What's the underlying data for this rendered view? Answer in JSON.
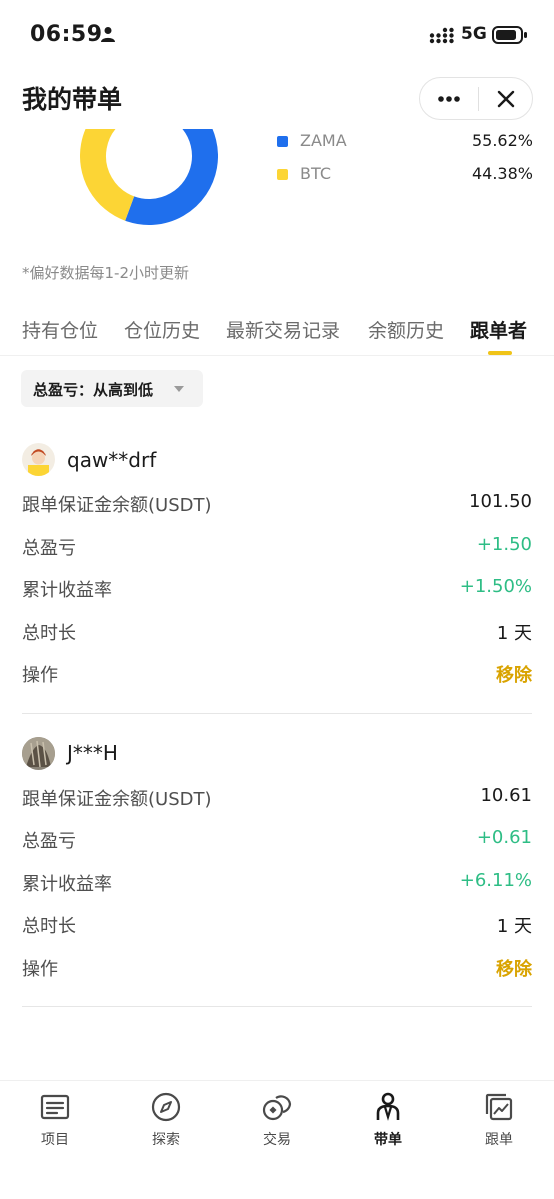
{
  "status_bar": {
    "time": "06:59",
    "network": "5G"
  },
  "header": {
    "title": "我的带单",
    "more_icon": "more-dots-icon",
    "close_icon": "close-icon"
  },
  "allocation": {
    "items": [
      {
        "name": "ZAMA",
        "value": "55.62%",
        "percent": 55.62,
        "color": "#1f6fed"
      },
      {
        "name": "BTC",
        "value": "44.38%",
        "percent": 44.38,
        "color": "#fcd535"
      }
    ],
    "note": "*偏好数据每1-2小时更新"
  },
  "tabs": [
    {
      "label": "持有仓位",
      "active": false
    },
    {
      "label": "仓位历史",
      "active": false
    },
    {
      "label": "最新交易记录",
      "active": false
    },
    {
      "label": "余额历史",
      "active": false
    },
    {
      "label": "跟单者",
      "active": true
    }
  ],
  "sort": {
    "label": "总盈亏：从高到低"
  },
  "followers": [
    {
      "name": "qaw**drf",
      "rows": [
        {
          "label": "跟单保证金余额(USDT)",
          "value": "101.50"
        },
        {
          "label": "总盈亏",
          "value": "+1.50"
        },
        {
          "label": "累计收益率",
          "value": "+1.50%"
        },
        {
          "label": "总时长",
          "value": "1 天"
        },
        {
          "label": "操作",
          "value": "移除"
        }
      ]
    },
    {
      "name": "J***H",
      "rows": [
        {
          "label": "跟单保证金余额(USDT)",
          "value": "10.61"
        },
        {
          "label": "总盈亏",
          "value": "+0.61"
        },
        {
          "label": "累计收益率",
          "value": "+6.11%"
        },
        {
          "label": "总时长",
          "value": "1 天"
        },
        {
          "label": "操作",
          "value": "移除"
        }
      ]
    }
  ],
  "bottom_nav": [
    {
      "label": "项目",
      "icon": "list-icon",
      "active": false
    },
    {
      "label": "探索",
      "icon": "compass-icon",
      "active": false
    },
    {
      "label": "交易",
      "icon": "trade-icon",
      "active": false
    },
    {
      "label": "带单",
      "icon": "person-icon",
      "active": true
    },
    {
      "label": "跟单",
      "icon": "copy-chart-icon",
      "active": false
    }
  ],
  "colors": {
    "accent": "#f0c419",
    "positive": "#2ebd85",
    "action": "#d9a300"
  }
}
